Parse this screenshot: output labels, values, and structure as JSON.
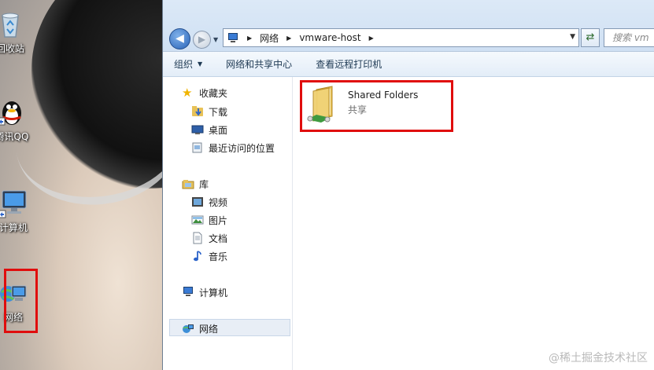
{
  "desktop": {
    "icons": [
      {
        "label": "回收站"
      },
      {
        "label": "腾讯QQ"
      },
      {
        "label": "计算机"
      },
      {
        "label": "网络"
      }
    ]
  },
  "window": {
    "address": {
      "crumbs": [
        "网络",
        "vmware-host"
      ],
      "search_placeholder": "搜索 vm"
    },
    "toolbar": {
      "organize": "组织",
      "network_center": "网络和共享中心",
      "printers": "查看远程打印机"
    },
    "nav": {
      "favorites": "收藏夹",
      "downloads": "下载",
      "desktop": "桌面",
      "recent": "最近访问的位置",
      "libraries": "库",
      "videos": "视频",
      "pictures": "图片",
      "documents": "文档",
      "music": "音乐",
      "computer": "计算机",
      "network": "网络"
    },
    "content": {
      "folder_name": "Shared Folders",
      "folder_subtitle": "共享"
    }
  },
  "watermark": "@稀土掘金技术社区",
  "colors": {
    "highlight_box": "#e00d0d",
    "address_bar": "#dce9f7"
  }
}
